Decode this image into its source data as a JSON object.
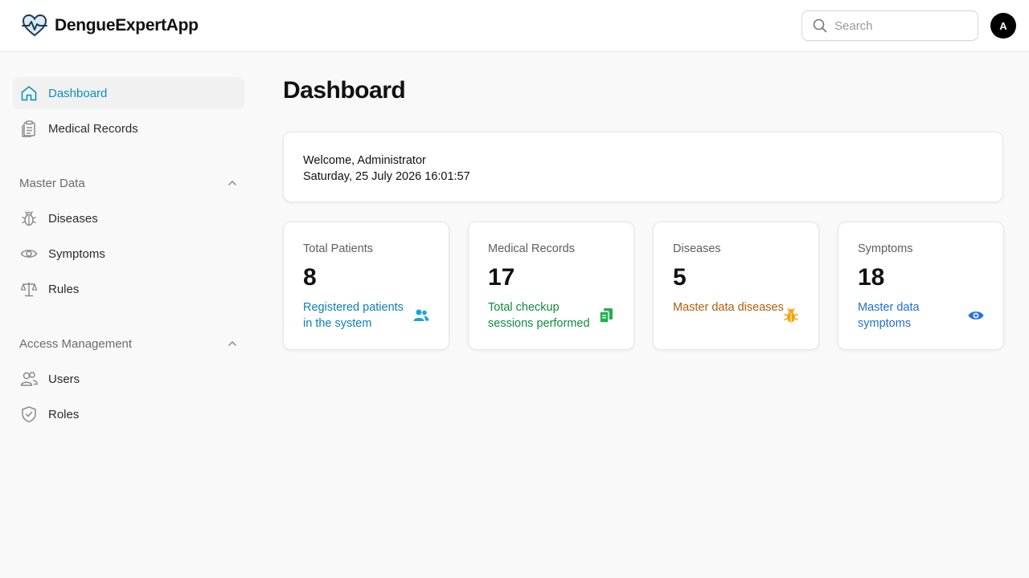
{
  "header": {
    "app_name": "DengueExpertApp",
    "search_placeholder": "Search",
    "avatar_initial": "A"
  },
  "sidebar": {
    "items": [
      {
        "label": "Dashboard",
        "icon": "home-icon",
        "active": true
      },
      {
        "label": "Medical Records",
        "icon": "clipboard-icon",
        "active": false
      }
    ],
    "groups": [
      {
        "label": "Master Data",
        "expanded": true,
        "items": [
          {
            "label": "Diseases",
            "icon": "bug-icon"
          },
          {
            "label": "Symptoms",
            "icon": "eye-icon"
          },
          {
            "label": "Rules",
            "icon": "scale-icon"
          }
        ]
      },
      {
        "label": "Access Management",
        "expanded": true,
        "items": [
          {
            "label": "Users",
            "icon": "users-icon"
          },
          {
            "label": "Roles",
            "icon": "shield-check-icon"
          }
        ]
      }
    ]
  },
  "main": {
    "title": "Dashboard",
    "welcome": {
      "greeting": "Welcome, Administrator",
      "datetime": "Saturday, 25 July 2026 16:01:57"
    },
    "stats": [
      {
        "title": "Total Patients",
        "value": "8",
        "description": "Registered patients in the system",
        "icon": "users-icon",
        "color": "#0b7fb3"
      },
      {
        "title": "Medical Records",
        "value": "17",
        "description": "Total checkup sessions performed",
        "icon": "documents-icon",
        "color": "#0f8a3e"
      },
      {
        "title": "Diseases",
        "value": "5",
        "description": "Master data diseases",
        "icon": "bug-icon",
        "color": "#b85c06"
      },
      {
        "title": "Symptoms",
        "value": "18",
        "description": "Master data symptoms",
        "icon": "eye-icon",
        "color": "#1f6fd1"
      }
    ]
  },
  "colors": {
    "accent": "#0b8fbf",
    "icon_users": "#1aa3e0",
    "icon_documents": "#22b04b",
    "icon_bug": "#f5a30c",
    "icon_eye": "#2374e1"
  }
}
